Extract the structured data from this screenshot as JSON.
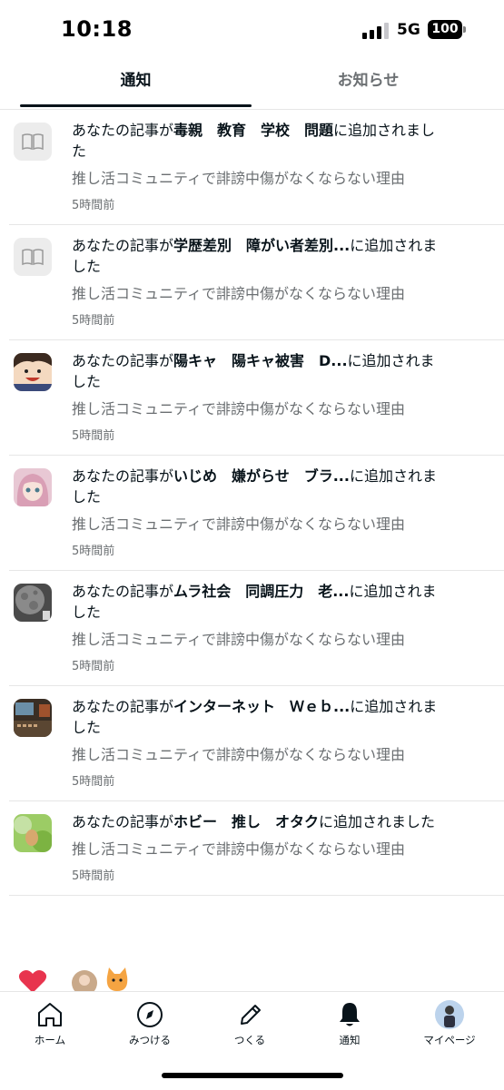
{
  "status_bar": {
    "time": "10:18",
    "network": "5G",
    "battery": "100"
  },
  "tabs": [
    {
      "label": "通知",
      "active": true
    },
    {
      "label": "お知らせ",
      "active": false
    }
  ],
  "notifications": [
    {
      "prefix": "あなたの記事が",
      "tag": "毒親　教育　学校　問題",
      "suffix_line1": "に追加されまし",
      "suffix_line2": "た",
      "article": "推し活コミュニティで誹謗中傷がなくならない理由",
      "time": "5時間前",
      "icon": "book-icon"
    },
    {
      "prefix": "あなたの記事が",
      "tag": "学歴差別　障がい者差別...",
      "suffix_line1": "に追加されま",
      "suffix_line2": "した",
      "article": "推し活コミュニティで誹謗中傷がなくならない理由",
      "time": "5時間前",
      "icon": "book-icon"
    },
    {
      "prefix": "あなたの記事が",
      "tag": "陽キャ　陽キャ被害　D...",
      "suffix_line1": "に追加されま",
      "suffix_line2": "した",
      "article": "推し活コミュニティで誹謗中傷がなくならない理由",
      "time": "5時間前",
      "icon": "smiling-character-avatar"
    },
    {
      "prefix": "あなたの記事が",
      "tag": "いじめ　嫌がらせ　ブラ...",
      "suffix_line1": "に追加されま",
      "suffix_line2": "した",
      "article": "推し活コミュニティで誹謗中傷がなくならない理由",
      "time": "5時間前",
      "icon": "anime-girl-avatar"
    },
    {
      "prefix": "あなたの記事が",
      "tag": "ムラ社会　同調圧力　老...",
      "suffix_line1": "に追加されま",
      "suffix_line2": "した",
      "article": "推し活コミュニティで誹謗中傷がなくならない理由",
      "time": "5時間前",
      "icon": "moon-avatar"
    },
    {
      "prefix": "あなたの記事が",
      "tag": "インターネット　Ｗｅｂ...",
      "suffix_line1": "に追加されま",
      "suffix_line2": "した",
      "article": "推し活コミュニティで誹謗中傷がなくならない理由",
      "time": "5時間前",
      "icon": "keyboard-avatar"
    },
    {
      "prefix": "あなたの記事が",
      "tag": "ホビー　推し　オタク",
      "suffix_line1": "に追加されました",
      "suffix_line2": "",
      "article": "推し活コミュニティで誹謗中傷がなくならない理由",
      "time": "5時間前",
      "icon": "green-photo-avatar"
    }
  ],
  "bottom_nav": [
    {
      "label": "ホーム",
      "icon": "home-icon"
    },
    {
      "label": "みつける",
      "icon": "compass-icon"
    },
    {
      "label": "つくる",
      "icon": "pencil-icon"
    },
    {
      "label": "通知",
      "icon": "bell-icon",
      "active": true
    },
    {
      "label": "マイページ",
      "icon": "profile-avatar-icon"
    }
  ],
  "colors": {
    "text": "#08131a",
    "muted": "#6b6f72",
    "divider": "#e6e6e6",
    "like": "#e8344e"
  }
}
